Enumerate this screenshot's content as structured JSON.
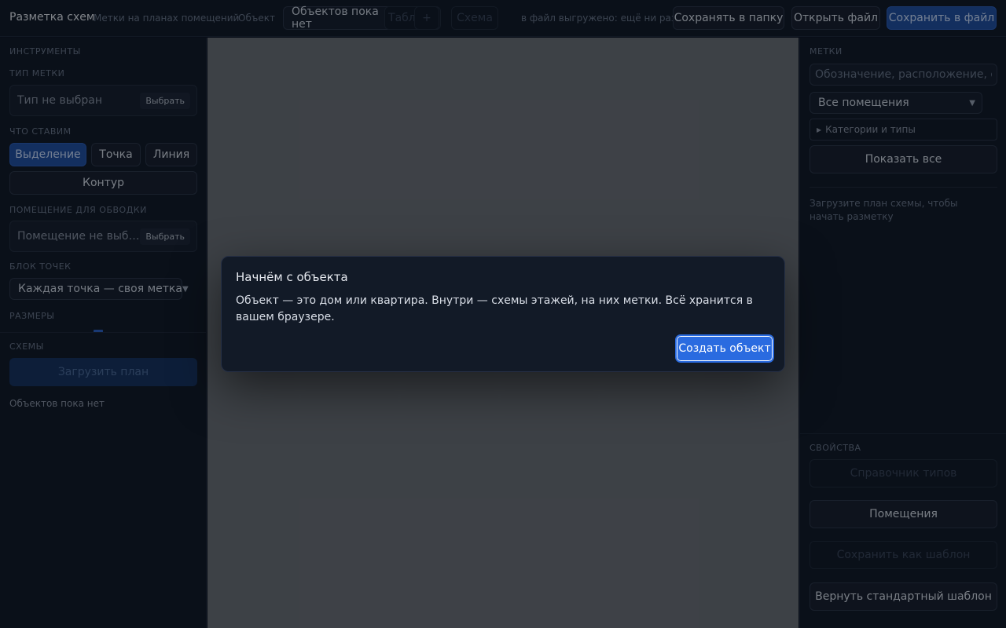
{
  "header": {
    "title": "Разметка схем",
    "subtitle": "Метки на планах помещений",
    "object_label": "Объект",
    "object_select_value": "Объектов пока нет",
    "table_tab": "Таблица",
    "add_glyph": "+",
    "scheme_tab": "Схема",
    "export_status": "в файл выгружено: ещё ни разу",
    "save_to_folder": "Сохранять в папку",
    "open_file": "Открыть файл",
    "save_to_file": "Сохранить в файл"
  },
  "left": {
    "tools_label": "ИНСТРУМЕНТЫ",
    "mark_type_label": "ТИП МЕТКИ",
    "mark_type_placeholder": "Тип не выбран",
    "pick_label": "Выбрать",
    "place_label": "ЧТО СТАВИМ",
    "modes": [
      "Выделение",
      "Точка",
      "Линия",
      "Контур"
    ],
    "active_mode": "Выделение",
    "outline_room_label": "ПОМЕЩЕНИЕ ДЛЯ ОБВОДКИ",
    "outline_room_placeholder": "Помещение не выбрано",
    "points_block_label": "БЛОК ТОЧЕК",
    "points_block_value": "Каждая точка — своя метка",
    "sizes_label": "РАЗМЕРЫ",
    "schemes_label": "СХЕМЫ",
    "load_plan": "Загрузить план",
    "no_objects": "Объектов пока нет"
  },
  "right": {
    "marks_label": "МЕТКИ",
    "search_placeholder": "Обозначение, расположение, оружие",
    "rooms_value": "Все помещения",
    "categories_toggle": "Категории и типы",
    "show_all": "Показать все",
    "hint": "Загрузите план схемы, чтобы начать разметку",
    "properties_label": "СВОЙСТВА",
    "types_ref": "Справочник типов",
    "rooms_btn": "Помещения",
    "save_template": "Сохранить как шаблон",
    "restore_template": "Вернуть стандартный шаблон"
  },
  "modal": {
    "title": "Начнём с объекта",
    "text": "Объект — это дом или квартира. Внутри — схемы этажей, на них метки. Всё хранится в вашем браузере.",
    "create_button": "Создать объект"
  },
  "colors": {
    "accent": "#2a6be0",
    "active": "#1f4fa3",
    "canvas": "#6c6f75"
  }
}
